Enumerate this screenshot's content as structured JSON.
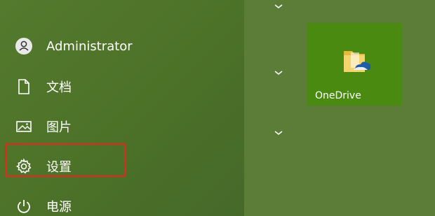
{
  "menu": {
    "items": [
      {
        "label": "Administrator",
        "icon": "user-avatar-icon"
      },
      {
        "label": "文档",
        "icon": "document-icon"
      },
      {
        "label": "图片",
        "icon": "picture-icon"
      },
      {
        "label": "设置",
        "icon": "gear-icon"
      },
      {
        "label": "电源",
        "icon": "power-icon"
      }
    ],
    "highlighted_item": "设置"
  },
  "tiles": [
    {
      "label": "OneDrive",
      "icon": "onedrive-folder-icon"
    }
  ],
  "colors": {
    "left_panel": "#4c7128",
    "right_panel": "#5b7d37",
    "tile_bg": "#4b8a10",
    "highlight_border": "#e8261e",
    "text": "#ffffff"
  }
}
